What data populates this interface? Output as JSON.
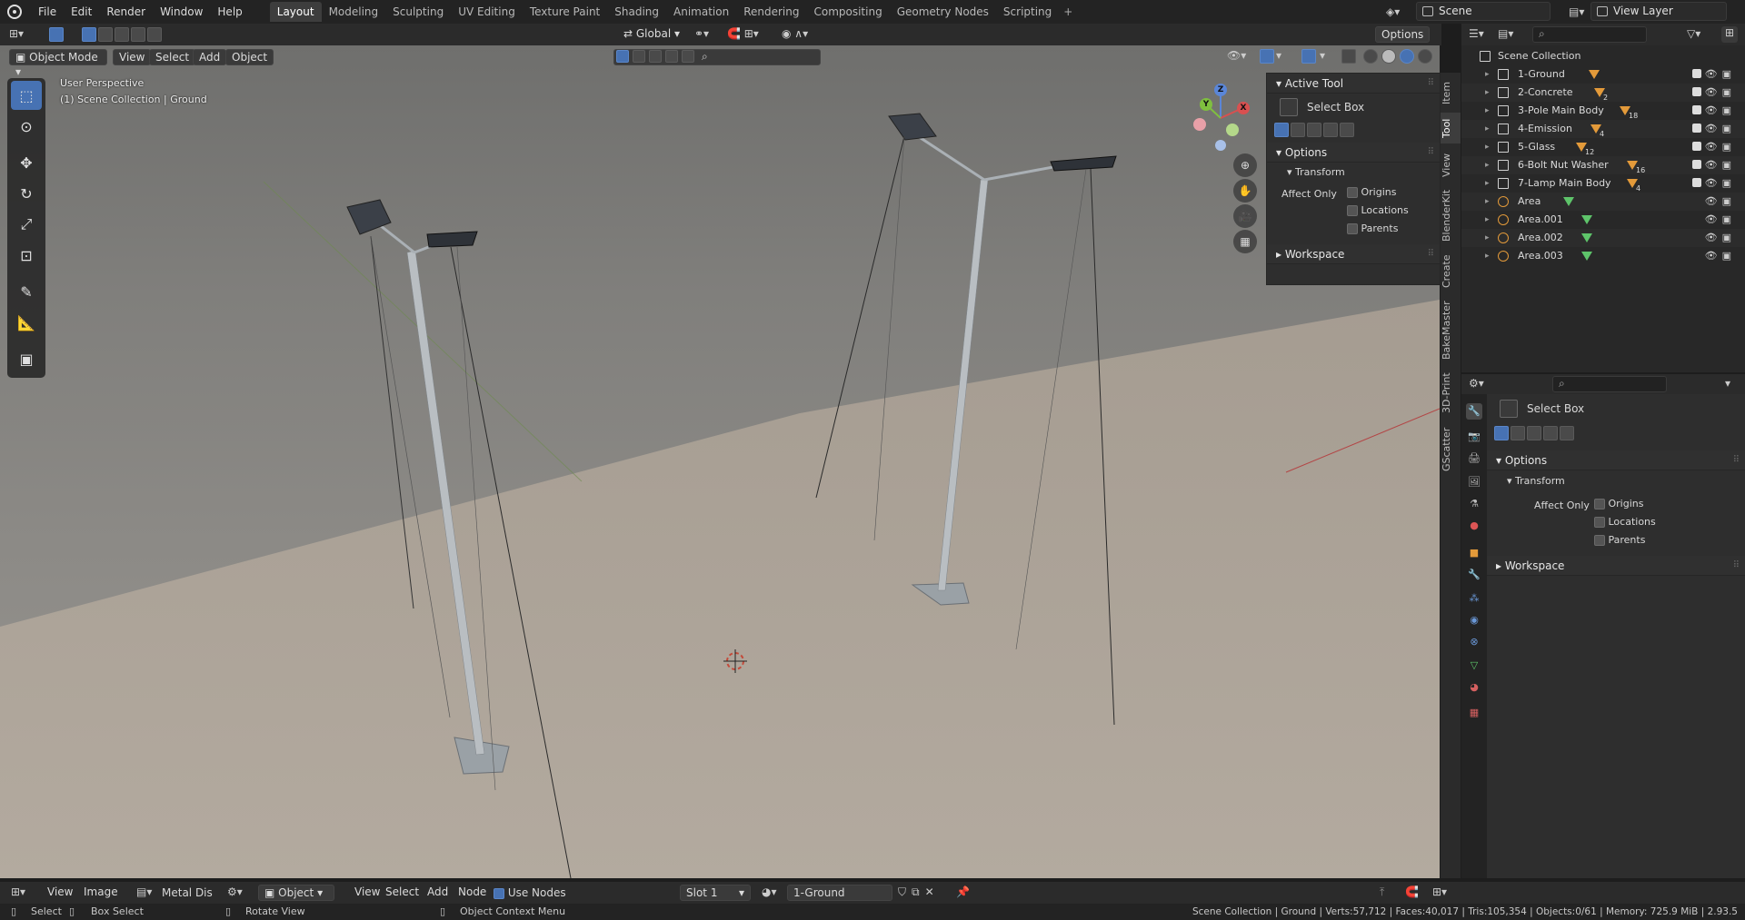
{
  "topbar": {
    "menus": [
      "File",
      "Edit",
      "Render",
      "Window",
      "Help"
    ],
    "workspaces": [
      "Layout",
      "Modeling",
      "Sculpting",
      "UV Editing",
      "Texture Paint",
      "Shading",
      "Animation",
      "Rendering",
      "Compositing",
      "Geometry Nodes",
      "Scripting"
    ],
    "active_workspace": "Layout",
    "scene": "Scene",
    "view_layer": "View Layer"
  },
  "viewport_header": {
    "mode": "Object Mode",
    "menus": [
      "View",
      "Select",
      "Add",
      "Object"
    ],
    "orientation": "Global",
    "options": "Options"
  },
  "viewport": {
    "perspective": "User Perspective",
    "collection_info": "(1) Scene Collection | Ground"
  },
  "npanel": {
    "tabs": [
      "Item",
      "Tool",
      "View",
      "BlenderKit",
      "Create",
      "BakeMaster",
      "3D-Print",
      "GScatter"
    ],
    "active_tab": "Tool",
    "active_tool_title": "Active Tool",
    "tool_name": "Select Box",
    "options_title": "Options",
    "transform_title": "Transform",
    "affect_only": "Affect Only",
    "checkboxes": [
      "Origins",
      "Locations",
      "Parents"
    ],
    "workspace_title": "Workspace"
  },
  "outliner": {
    "root": "Scene Collection",
    "items": [
      {
        "name": "1-Ground",
        "type": "collection",
        "count": ""
      },
      {
        "name": "2-Concrete",
        "type": "collection",
        "count": "2"
      },
      {
        "name": "3-Pole Main Body",
        "type": "collection",
        "count": "18"
      },
      {
        "name": "4-Emission",
        "type": "collection",
        "count": "4"
      },
      {
        "name": "5-Glass",
        "type": "collection",
        "count": "12"
      },
      {
        "name": "6-Bolt Nut Washer",
        "type": "collection",
        "count": "16"
      },
      {
        "name": "7-Lamp Main Body",
        "type": "collection",
        "count": "4"
      },
      {
        "name": "Area",
        "type": "light",
        "count": ""
      },
      {
        "name": "Area.001",
        "type": "light",
        "count": ""
      },
      {
        "name": "Area.002",
        "type": "light",
        "count": ""
      },
      {
        "name": "Area.003",
        "type": "light",
        "count": ""
      }
    ]
  },
  "properties": {
    "tool_name": "Select Box",
    "options_title": "Options",
    "transform_title": "Transform",
    "affect_only": "Affect Only",
    "checkboxes": [
      "Origins",
      "Locations",
      "Parents"
    ],
    "workspace_title": "Workspace"
  },
  "node_header": {
    "menus": [
      "View",
      "Image"
    ],
    "material_dropdown": "Metal Dis",
    "object_dropdown": "Object",
    "menus2": [
      "View",
      "Select",
      "Add",
      "Node"
    ],
    "use_nodes": "Use Nodes",
    "slot": "Slot 1",
    "material": "1-Ground"
  },
  "statusbar": {
    "select": "Select",
    "box_select": "Box Select",
    "rotate_view": "Rotate View",
    "context_menu": "Object Context Menu",
    "stats": "Scene Collection | Ground | Verts:57,712 | Faces:40,017 | Tris:105,354 | Objects:0/61 | Memory: 725.9 MiB | 2.93.5"
  },
  "colors": {
    "accent": "#4772b3",
    "light_icon": "#e39a3a"
  }
}
